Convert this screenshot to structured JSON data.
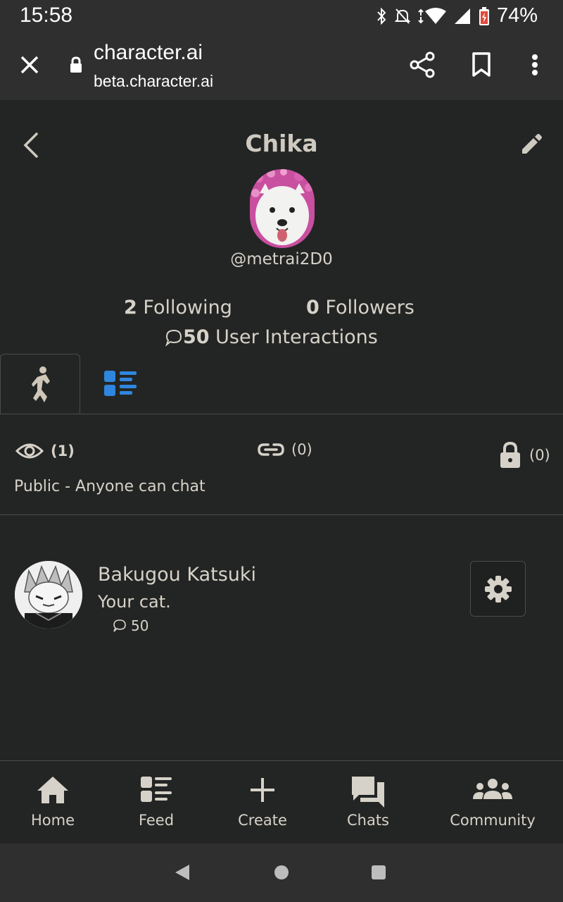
{
  "status": {
    "time": "15:58",
    "battery": "74%"
  },
  "browser": {
    "title": "character.ai",
    "url": "beta.character.ai"
  },
  "profile": {
    "name": "Chika",
    "handle": "@metrai2D0",
    "following_count": "2",
    "following_label": "Following",
    "followers_count": "0",
    "followers_label": "Followers",
    "interactions_count": "50",
    "interactions_label": "User Interactions"
  },
  "visibility": {
    "public_count": "(1)",
    "link_count": "(0)",
    "private_count": "(0)",
    "description": "Public - Anyone can chat"
  },
  "characters": [
    {
      "name": "Bakugou Katsuki",
      "description": "Your cat.",
      "interactions": "50"
    }
  ],
  "nav": {
    "home": "Home",
    "feed": "Feed",
    "create": "Create",
    "chats": "Chats",
    "community": "Community"
  },
  "colors": {
    "accent_blue": "#2f86de",
    "background": "#232524",
    "chrome": "#2f2f2f"
  }
}
